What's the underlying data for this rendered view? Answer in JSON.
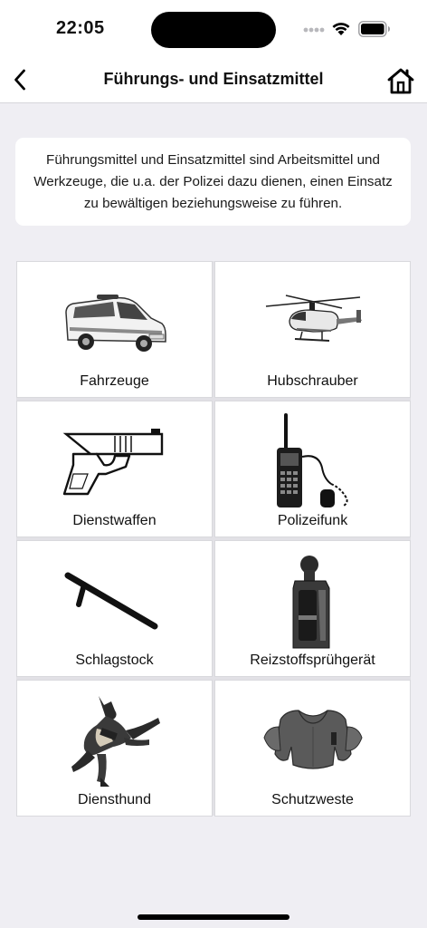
{
  "status_bar": {
    "time": "22:05"
  },
  "nav": {
    "title": "Führungs- und Einsatzmittel",
    "back_icon": "chevron-left-icon",
    "home_icon": "house-icon"
  },
  "intro": {
    "text": "Führungsmittel und Einsatzmittel sind Arbeitsmittel und Werkzeuge, die u.a. der Polizei dazu dienen, einen Einsatz zu bewältigen beziehungsweise zu führen."
  },
  "tiles": [
    {
      "label": "Fahrzeuge",
      "image": "police-van"
    },
    {
      "label": "Hubschrauber",
      "image": "police-helicopter"
    },
    {
      "label": "Dienstwaffen",
      "image": "pistol"
    },
    {
      "label": "Polizeifunk",
      "image": "radio"
    },
    {
      "label": "Schlagstock",
      "image": "baton"
    },
    {
      "label": "Reizstoffsprühgerät",
      "image": "pepper-spray"
    },
    {
      "label": "Diensthund",
      "image": "police-dog"
    },
    {
      "label": "Schutzweste",
      "image": "protective-vest"
    }
  ]
}
